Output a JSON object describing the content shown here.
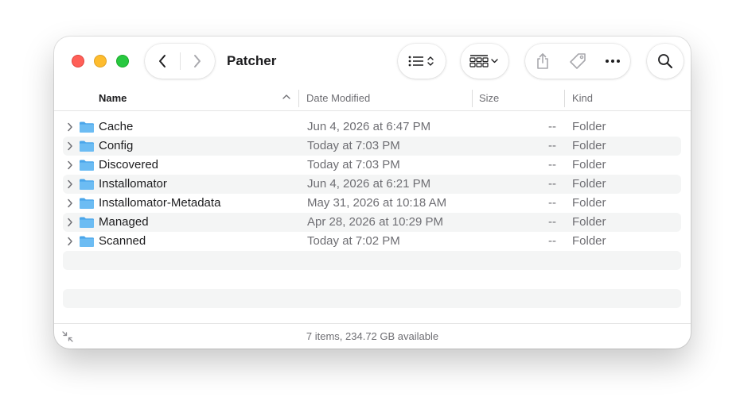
{
  "window": {
    "title": "Patcher"
  },
  "toolbar": {
    "back": "chevron-left-icon",
    "forward": "chevron-right-icon",
    "view_options": "list-view-icon",
    "group": "grid-group-icon",
    "share": "share-icon",
    "tag": "tag-icon",
    "more": "ellipsis-icon",
    "search": "magnifier-icon"
  },
  "columns": {
    "name": "Name",
    "date_modified": "Date Modified",
    "size": "Size",
    "kind": "Kind"
  },
  "files": [
    {
      "name": "Cache",
      "date": "Jun 4, 2026 at 6:47 PM",
      "size": "--",
      "kind": "Folder"
    },
    {
      "name": "Config",
      "date": "Today at 7:03 PM",
      "size": "--",
      "kind": "Folder"
    },
    {
      "name": "Discovered",
      "date": "Today at 7:03 PM",
      "size": "--",
      "kind": "Folder"
    },
    {
      "name": "Installomator",
      "date": "Jun 4, 2026 at 6:21 PM",
      "size": "--",
      "kind": "Folder"
    },
    {
      "name": "Installomator-Metadata",
      "date": "May 31, 2026 at 10:18 AM",
      "size": "--",
      "kind": "Folder"
    },
    {
      "name": "Managed",
      "date": "Apr 28, 2026 at 10:29 PM",
      "size": "--",
      "kind": "Folder"
    },
    {
      "name": "Scanned",
      "date": "Today at 7:02 PM",
      "size": "--",
      "kind": "Folder"
    }
  ],
  "status": {
    "text": "7 items, 234.72 GB available"
  },
  "colors": {
    "close": "#ff5f57",
    "minimize": "#febc2e",
    "maximize": "#28c840",
    "folder": "#5eb4f0",
    "stripe": "#f4f5f5",
    "secondary_text": "#6e6e73"
  }
}
